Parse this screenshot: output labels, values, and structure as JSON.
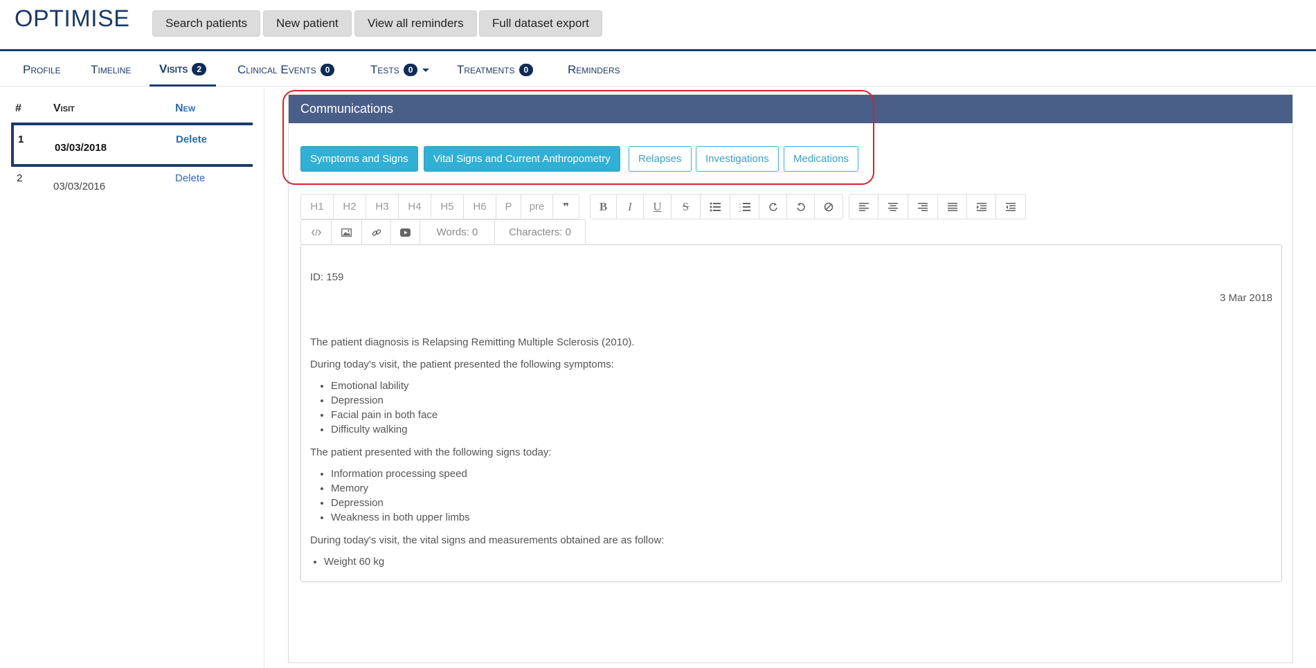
{
  "header": {
    "title": "OPTIMISE",
    "buttons": [
      "Search patients",
      "New patient",
      "View all reminders",
      "Full dataset export"
    ]
  },
  "tabs": [
    {
      "label": "Profile",
      "badge": null
    },
    {
      "label": "Timeline",
      "badge": null
    },
    {
      "label": "Visits",
      "badge": "2"
    },
    {
      "label": "Clinical Events",
      "badge": "0"
    },
    {
      "label": "Tests",
      "badge": "0"
    },
    {
      "label": "Treatments",
      "badge": "0"
    },
    {
      "label": "Reminders",
      "badge": null
    }
  ],
  "visits_table": {
    "headers": {
      "num": "#",
      "visit": "Visit",
      "new": "New"
    },
    "rows": [
      {
        "num": "1",
        "date": "03/03/2018",
        "action": "Delete"
      },
      {
        "num": "2",
        "date": "03/03/2016",
        "action": "Delete"
      }
    ]
  },
  "communications": {
    "title": "Communications",
    "buttons": [
      "Symptoms and Signs",
      "Vital Signs and Current Anthropometry",
      "Relapses",
      "Investigations",
      "Medications"
    ]
  },
  "toolbar": {
    "headings": [
      "H1",
      "H2",
      "H3",
      "H4",
      "H5",
      "H6",
      "P",
      "pre",
      "❞"
    ],
    "format_icons": [
      "bold-icon",
      "italic-icon",
      "underline-icon",
      "strikethrough-icon",
      "bullet-list-icon",
      "numbered-list-icon",
      "redo-icon",
      "undo-icon",
      "clear-format-icon"
    ],
    "align_icons": [
      "align-left-icon",
      "align-center-icon",
      "align-right-icon",
      "align-justify-icon",
      "indent-icon",
      "outdent-icon"
    ],
    "insert_icons": [
      "code-icon",
      "image-icon",
      "link-icon",
      "video-icon"
    ],
    "words": "Words: 0",
    "characters": "Characters: 0"
  },
  "editor": {
    "id_line": "ID: 159",
    "date": "3 Mar 2018",
    "diagnosis": "The patient diagnosis is Relapsing Remitting Multiple Sclerosis (2010).",
    "symptoms_intro": "During today's visit, the patient presented the following symptoms:",
    "symptoms": [
      "Emotional lability",
      "Depression",
      "Facial pain in both face",
      "Difficulty walking"
    ],
    "signs_intro": "The patient presented with the following signs today:",
    "signs": [
      "Information processing speed",
      "Memory",
      "Depression",
      "Weakness in both upper limbs"
    ],
    "vitals_intro": "During today's visit, the vital signs and measurements obtained are as follow:",
    "vitals": [
      "Weight 60 kg"
    ]
  }
}
